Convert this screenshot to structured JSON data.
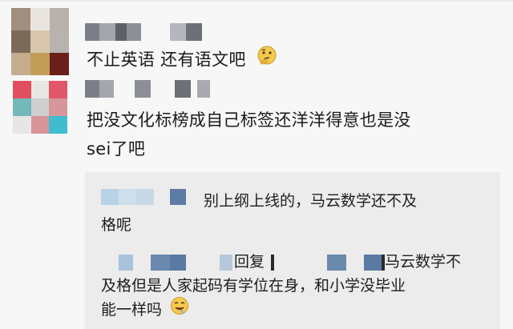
{
  "comments": [
    {
      "text": "不止英语 还有语文吧",
      "emoji": "thinking-face-icon"
    },
    {
      "lines": [
        "把没文化标榜成自己标签还洋洋得意也是没",
        "sei了吧"
      ]
    }
  ],
  "replies": [
    {
      "lines": [
        "别上纲上线的，马云数学还不及",
        "格呢"
      ]
    },
    {
      "reply_word": "回复",
      "tail": "马云数学不",
      "lines": [
        "及格但是人家起码有学位在身，和小学没毕业",
        "能一样吗"
      ],
      "emoji": "drooling-face-icon"
    }
  ],
  "colors": {
    "background": "#f7f7f7",
    "reply_box": "#ececec",
    "text": "#1a1a1a"
  }
}
